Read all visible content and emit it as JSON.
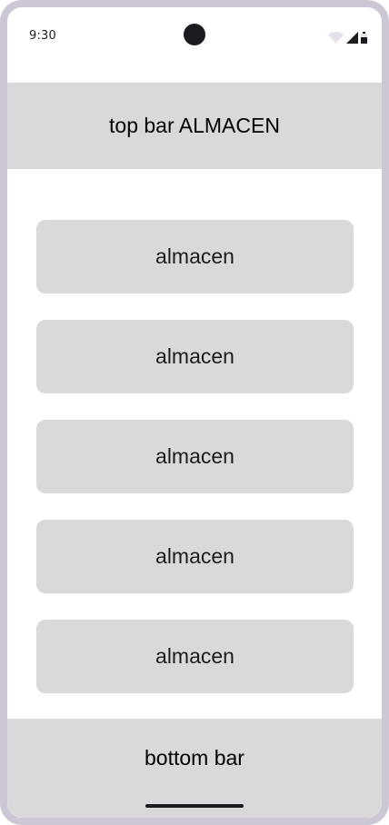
{
  "status_bar": {
    "time": "9:30",
    "icons": [
      "wifi-icon",
      "signal-icon",
      "battery-icon"
    ]
  },
  "top_bar": {
    "title": "top bar ALMACEN"
  },
  "list": {
    "items": [
      {
        "label": "almacen"
      },
      {
        "label": "almacen"
      },
      {
        "label": "almacen"
      },
      {
        "label": "almacen"
      },
      {
        "label": "almacen"
      }
    ]
  },
  "bottom_bar": {
    "label": "bottom bar"
  },
  "colors": {
    "frame": "#cdc6d4",
    "bar_background": "#d9d9d9",
    "button_background": "#d9d9d9",
    "text_dark": "#1d1b20"
  }
}
